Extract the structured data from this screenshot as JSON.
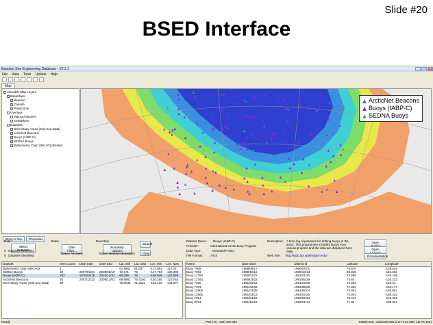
{
  "slide": {
    "number": "Slide #20",
    "title": "BSED Interface"
  },
  "window": {
    "title": "Beaufort Sea Engineering Database - V2.2.1",
    "controls": [
      "_",
      "□",
      "×"
    ]
  },
  "menu": [
    "File",
    "View",
    "Tools",
    "Update",
    "Help"
  ],
  "tab_label": "Map",
  "tree": [
    {
      "label": "Viewable Map Layers",
      "indent": 0
    },
    {
      "label": "BaseMaps",
      "indent": 1
    },
    {
      "label": "Beaufort",
      "indent": 2
    },
    {
      "label": "Canada",
      "indent": 2
    },
    {
      "label": "PolarCircle",
      "indent": 2
    },
    {
      "label": "Overlays",
      "indent": 1
    },
    {
      "label": "MaxIceAnExtent",
      "indent": 2
    },
    {
      "label": "IceMarkers",
      "indent": 2
    },
    {
      "label": "Datasets",
      "indent": 1
    },
    {
      "label": "OCS Study Areas (Sub-Sea Data)",
      "indent": 2
    },
    {
      "label": "ArcticNet Beacons",
      "indent": 2
    },
    {
      "label": "Buoys (IABP-C)",
      "indent": 2
    },
    {
      "label": "SEDNA Buoys",
      "indent": 2
    },
    {
      "label": "Bathymetric Chart (IBCAO) [Raster]",
      "indent": 2
    }
  ],
  "legend": [
    {
      "label": "ArcticNet Beacons",
      "color": "#4a6fd6"
    },
    {
      "label": "Buoys (IABP-C)",
      "color": "#8a2be2"
    },
    {
      "label": "SEDNA Buoys",
      "color": "#4caf50"
    }
  ],
  "left_buttons": [
    "Bring to Top",
    "Properties"
  ],
  "controls": {
    "data_label": "Data",
    "select_datasets": "Select Datasets",
    "datasets_selected": "Datasets Selected",
    "datasets_selected_n": "5",
    "datasets_identified": "Datasets Identified",
    "datasets_identified_n": "0",
    "dates_label": "Dates",
    "date_filter": "Date Filter...",
    "status_dates": "Status: All Dates",
    "boundary_label": "Boundary",
    "boundary_options": "Boundary Options",
    "status_boundary": "Status: Beaufort Boundary",
    "search": "Search",
    "clear": "Clear"
  },
  "details": {
    "dataset_name_label": "Dataset Name:",
    "dataset_name": "Buoys (IABP-C)",
    "provider_label": "Provider:",
    "provider": "International Arctic Buoy Program",
    "data_type_label": "Data Type:",
    "data_type": "Animated Points",
    "file_format_label": "File Format:",
    "file_format": "Ascii",
    "description_label": "Description:",
    "description": "A time-log of positions for drifting buoys in the arctic. This programme includes buoys from various projects and the data are displayed here daily.",
    "website_label": "Web Site:",
    "website": "http://iabp.apl.washington.edu/",
    "btn_open_folder": "Open Folder",
    "btn_open_licence": "Open Licence",
    "btn_documentation": "Documentation"
  },
  "datasets_table": {
    "columns": [
      "Dataset",
      "Item Count",
      "Date Start",
      "Date End",
      "Lat. Min",
      "Lat. Max",
      "Lon. Min",
      "Lon. Max"
    ],
    "rows": [
      [
        "Bathymetric Chart (IBCAO)",
        "1",
        "",
        "",
        "61.9861",
        "81.637",
        "-171.891",
        "-112.31"
      ],
      [
        "SEDNA Buoys",
        "23",
        "2007/01/01",
        "2008/06/10",
        "72.171",
        "76",
        "-147.703",
        "-136.383"
      ],
      [
        "Buoys (IABP-C)",
        "282",
        "1978/02/18",
        "2010/12/31",
        "68.398",
        "76",
        "-165.845",
        "-122.069"
      ],
      [
        "ArcticNet Beacons",
        "28",
        "2007/11/22",
        "2009/12/03",
        "69.6981",
        "75.4193",
        "-130.285",
        "-122.062"
      ],
      [
        "OCS Study Areas (Sub-Sea Data)",
        "38",
        "",
        "",
        "70.0049",
        "71.3121",
        "-155.139",
        "-141.277"
      ]
    ]
  },
  "items_table": {
    "columns": [
      "Name",
      "Date Start",
      "Date End",
      "Latitude",
      "Longitude"
    ],
    "rows": [
      [
        "Buoy 7808",
        "1989/08/17",
        "1990/07/01",
        "75.878",
        "-135.525"
      ],
      [
        "Buoy 7093",
        "1989/10/12",
        "1989/10/13",
        "69.815",
        "-154.263"
      ],
      [
        "Buoy 12782",
        "1990/01/22",
        "1991/01/20",
        "73.988",
        "-148.109"
      ],
      [
        "Buoy 12783",
        "1990/03/22",
        "1991/05/29",
        "74.80",
        "-130.223"
      ],
      [
        "Buoy 7100",
        "1991/02/12",
        "1991/04/08",
        "72.064",
        "-162.24"
      ],
      [
        "Buoy 7101",
        "1991/02/02",
        "1992/06/28",
        "71.833",
        "-152.177"
      ],
      [
        "Buoy 12800",
        "1991/03/09",
        "1992/05/04",
        "74.981",
        "-150.951"
      ],
      [
        "Buoy 12806",
        "1991/03/13",
        "1992/02/26",
        "74.931",
        "-155.342"
      ],
      [
        "Buoy 7014",
        "1991/04/23",
        "1992/02/23",
        "73.444",
        "-146.481"
      ],
      [
        "Buoy 9794",
        "1991/10/12",
        "1992/01/14",
        "71.33",
        "-138.364"
      ]
    ]
  },
  "status": {
    "left": "Ready",
    "center": "P50 (76, -145) W0 084",
    "right": "93090.426, -2165938.984 (Lon:-142.585, Lat:75.102)"
  }
}
